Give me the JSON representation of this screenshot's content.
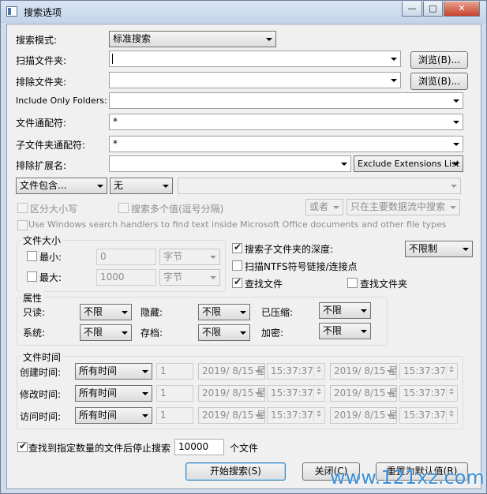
{
  "window": {
    "title": "搜索选项",
    "min_label": "—",
    "max_label": "□",
    "close_label": "✕"
  },
  "search_mode": {
    "label": "搜索模式:",
    "value": "标准搜索"
  },
  "scan_folders": {
    "label": "扫描文件夹:",
    "value": "",
    "browse_label": "浏览(B)..."
  },
  "exclude_folders": {
    "label": "排除文件夹:",
    "value": "",
    "browse_label": "浏览(B)..."
  },
  "include_only": {
    "label": "Include Only Folders:",
    "value": ""
  },
  "file_wildcard": {
    "label": "文件通配符:",
    "value": "*"
  },
  "subfolder_wildcard": {
    "label": "子文件夹通配符:",
    "value": "*"
  },
  "exclude_ext": {
    "label": "排除扩展名:",
    "value": "",
    "mode": "Exclude Extensions List"
  },
  "contains": {
    "type": "文件包含...",
    "mode": "无",
    "value": ""
  },
  "options": {
    "case_sensitive": "区分大小写",
    "multi_values": "搜索多个值(逗号分隔)",
    "or_value": "或者",
    "stream_value": "只在主要数据流中搜索",
    "windows_handlers": "Use Windows search handlers to find text inside Microsoft Office documents and other file types"
  },
  "file_size": {
    "title": "文件大小",
    "min_label": "最小:",
    "min_value": "0",
    "min_unit": "字节",
    "max_label": "最大:",
    "max_value": "1000",
    "max_unit": "字节"
  },
  "subfolder_depth": {
    "label": "搜索子文件夹的深度:",
    "value": "不限制"
  },
  "scan_ntfs": {
    "label": "扫描NTFS符号链接/连接点"
  },
  "find_files": {
    "label": "查找文件"
  },
  "find_folders": {
    "label": "查找文件夹"
  },
  "attributes": {
    "title": "属性",
    "readonly": {
      "label": "只读:",
      "value": "不限"
    },
    "hidden": {
      "label": "隐藏:",
      "value": "不限"
    },
    "compressed": {
      "label": "已压缩:",
      "value": "不限"
    },
    "system": {
      "label": "系统:",
      "value": "不限"
    },
    "archive": {
      "label": "存档:",
      "value": "不限"
    },
    "encrypted": {
      "label": "加密:",
      "value": "不限"
    }
  },
  "file_time": {
    "title": "文件时间",
    "rows": [
      {
        "label": "创建时间:",
        "mode": "所有时间",
        "count": "1",
        "date1": "2019/ 8/15 星",
        "time1": "15:37:37",
        "date2": "2019/ 8/15 星",
        "time2": "15:37:37"
      },
      {
        "label": "修改时间:",
        "mode": "所有时间",
        "count": "1",
        "date1": "2019/ 8/15 星",
        "time1": "15:37:37",
        "date2": "2019/ 8/15 星",
        "time2": "15:37:37"
      },
      {
        "label": "访问时间:",
        "mode": "所有时间",
        "count": "1",
        "date1": "2019/ 8/15 星",
        "time1": "15:37:37",
        "date2": "2019/ 8/15 星",
        "time2": "15:37:37"
      }
    ]
  },
  "stop_after": {
    "label": "查找到指定数量的文件后停止搜索",
    "value": "10000",
    "unit": "个文件"
  },
  "buttons": {
    "start": "开始搜索(S)",
    "close": "关闭(C)",
    "reset": "重置为默认值(R)"
  },
  "watermark": "www.121xz.com"
}
